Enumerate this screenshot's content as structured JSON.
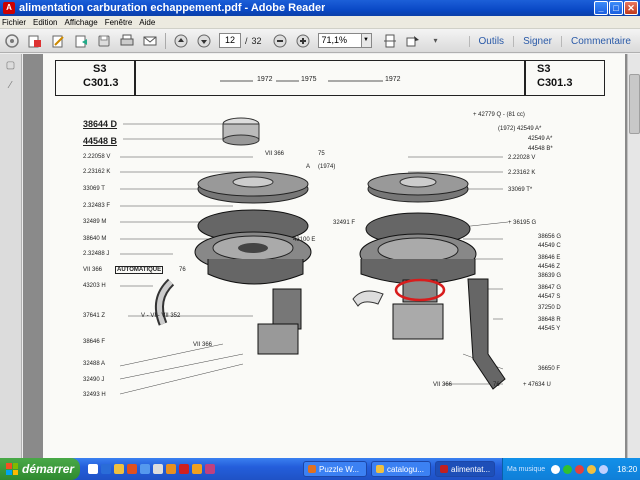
{
  "window": {
    "title": "alimentation carburation echappement.pdf - Adobe Reader",
    "buttons": {
      "minimize": "_",
      "maximize": "□",
      "close": "✕"
    }
  },
  "menu": [
    "Fichier",
    "Edition",
    "Affichage",
    "Fenêtre",
    "Aide"
  ],
  "toolbar": {
    "page_current": "12",
    "page_separator": "/",
    "page_total": "32",
    "zoom": "71,1%",
    "links": [
      "Outils",
      "Signer",
      "Commentaire"
    ],
    "icons": [
      "create-pdf-icon",
      "open-icon",
      "edit-icon",
      "share-icon",
      "save-icon",
      "print-icon",
      "email-icon",
      "prev-page-icon",
      "next-page-icon",
      "zoom-out-icon",
      "zoom-in-icon",
      "fit-page-icon",
      "interactive-icon",
      "more-icon"
    ]
  },
  "document": {
    "header_left": {
      "line1": "S3",
      "line2": "C301.3"
    },
    "header_right": {
      "line1": "S3",
      "line2": "C301.3"
    },
    "header_center": {
      "date1": "1972",
      "date2": "1975",
      "date3": "1972"
    },
    "left_parts": [
      {
        "num": "38644 D",
        "big": true
      },
      {
        "num": "44548 B",
        "big": true
      },
      {
        "num": "2.22058 V"
      },
      {
        "num": "2.23162 K"
      },
      {
        "num": "33069 T"
      },
      {
        "num": "2.32483 F"
      },
      {
        "num": "32489 M"
      },
      {
        "num": "38640 M"
      },
      {
        "num": "2.32488 J"
      },
      {
        "num": "43203 H"
      },
      {
        "num": "37641 Z"
      },
      {
        "num": "38646 F"
      },
      {
        "num": "32488 A"
      },
      {
        "num": "32490 J"
      },
      {
        "num": "32493 H"
      }
    ],
    "right_parts": [
      {
        "num": "+ 42779 Q - (81 cc)"
      },
      {
        "num": "(1972)  42549 A*"
      },
      {
        "num": "42549 A*"
      },
      {
        "num": "44548 B*"
      },
      {
        "num": "2.22028 V"
      },
      {
        "num": "2.23162 K"
      },
      {
        "num": "33069 T*"
      },
      {
        "num": "+ 36195 G"
      },
      {
        "num": "38656 G"
      },
      {
        "num": "44549 C"
      },
      {
        "num": "38646 E"
      },
      {
        "num": "44546 Z"
      },
      {
        "num": "38639 G"
      },
      {
        "num": "38647 G"
      },
      {
        "num": "44547 S"
      },
      {
        "num": "37250 D"
      },
      {
        "num": "38648 R"
      },
      {
        "num": "44545 Y"
      },
      {
        "num": "36650 F"
      },
      {
        "num": "+ 47634 U"
      }
    ],
    "center_labels": [
      "VII 366",
      "75",
      "A",
      "(1974)",
      "32491 F",
      "43100 E",
      "VII 366",
      "AUTOMATIQUE",
      "76",
      "V - VI - VII 352",
      "VII 366",
      "VII 366",
      "76"
    ]
  },
  "taskbar": {
    "start": "démarrer",
    "tasks": [
      {
        "label": "Puzzle W...",
        "color": "#e07020"
      },
      {
        "label": "catalogu...",
        "color": "#f0c040"
      },
      {
        "label": "alimentat...",
        "color": "#c02020",
        "active": true
      }
    ],
    "tray_label": "Ma musique",
    "clock": "18:20"
  },
  "colors": {
    "highlight_circle": "#d81c1c",
    "title_bar": "#0a49c6",
    "taskbar": "#245edb",
    "start": "#3a9a3a"
  }
}
